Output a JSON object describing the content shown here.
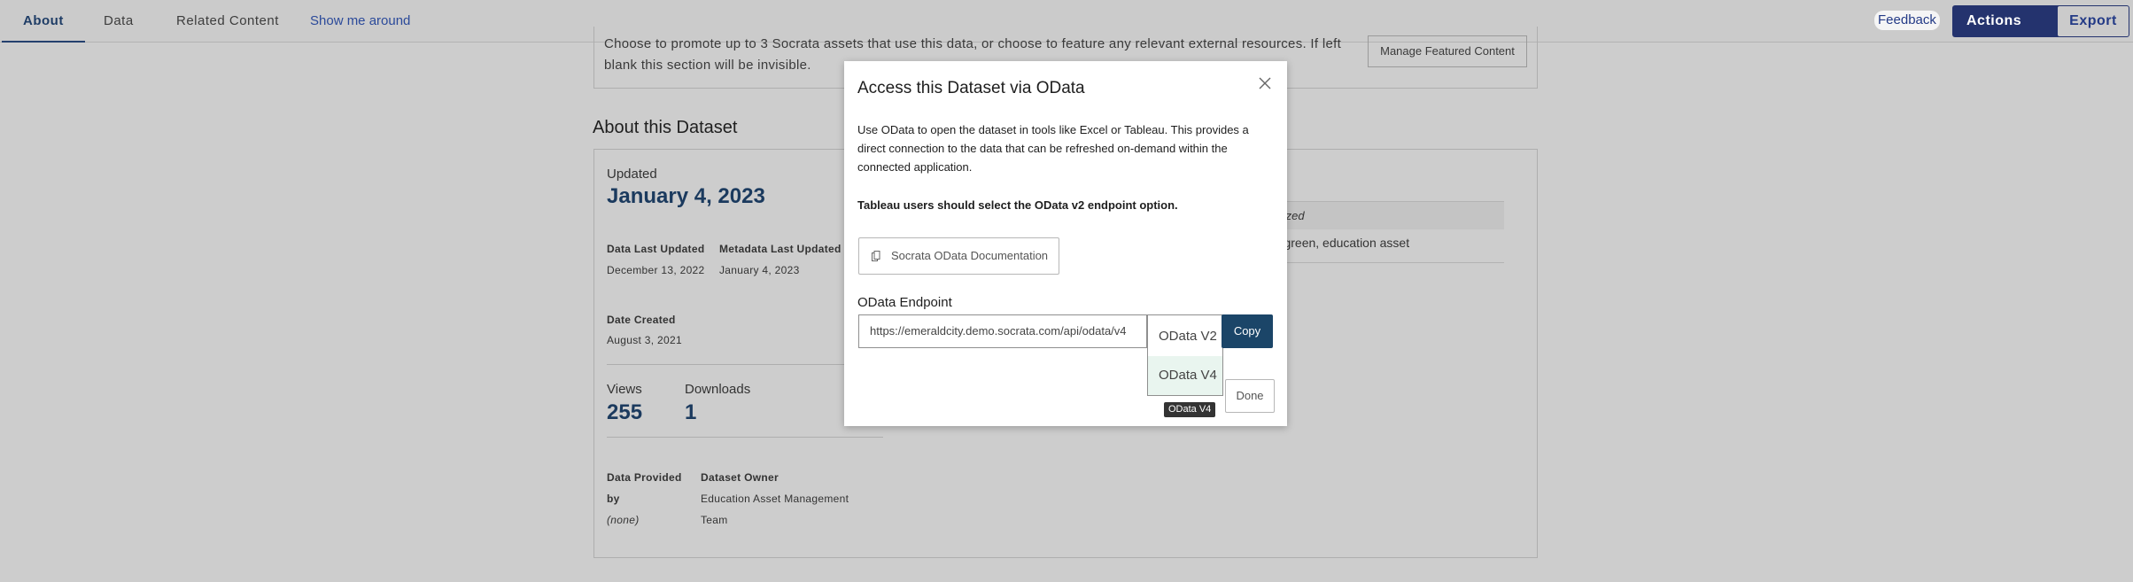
{
  "nav": {
    "tabs": [
      {
        "label": "About"
      },
      {
        "label": "Data"
      },
      {
        "label": "Related Content"
      }
    ],
    "tour_label": "Show me around",
    "feedback_label": "Feedback",
    "actions_label": "Actions",
    "export_label": "Export"
  },
  "featured": {
    "text": "Choose to promote up to 3 Socrata assets that use this data, or choose to feature any relevant external resources. If left blank this section will be invisible.",
    "manage_label": "Manage Featured Content"
  },
  "about": {
    "title": "About this Dataset",
    "updated_label": "Updated",
    "updated_date": "January 4, 2023",
    "data_last_updated_label": "Data Last Updated",
    "data_last_updated": "December 13, 2022",
    "metadata_last_updated_label": "Metadata Last Updated",
    "metadata_last_updated": "January 4, 2023",
    "date_created_label": "Date Created",
    "date_created": "August 3, 2021",
    "views_label": "Views",
    "views": "255",
    "downloads_label": "Downloads",
    "downloads": "1",
    "data_provided_label_1": "Data Provided",
    "data_provided_label_2": "by",
    "data_provided": "(none)",
    "owner_label": "Dataset Owner",
    "owner_line1": "Education Asset Management",
    "owner_line2": "Team",
    "tags_header": "gorized",
    "tags": "nt, green, education asset"
  },
  "modal": {
    "title": "Access this Dataset via OData",
    "body": "Use OData to open the dataset in tools like Excel or Tableau. This provides a direct connection to the data that can be refreshed on-demand within the connected application.",
    "warning": "Tableau users should select the OData v2 endpoint option.",
    "doc_button_label": "Socrata OData Documentation",
    "endpoint_label": "OData Endpoint",
    "endpoint_value": "https://emeraldcity.demo.socrata.com/api/odata/v4",
    "options": [
      "OData V2",
      "OData V4"
    ],
    "copy_label": "Copy",
    "done_label": "Done",
    "tooltip": "OData V4"
  }
}
